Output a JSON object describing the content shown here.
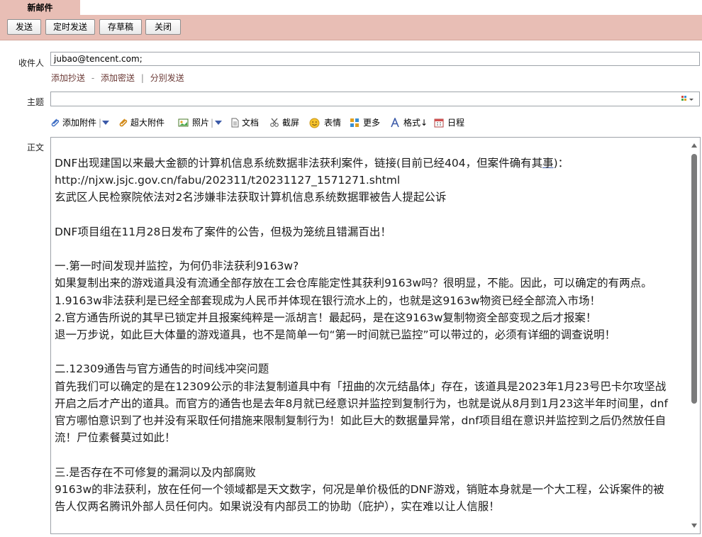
{
  "tab": {
    "title": "新邮件"
  },
  "toolbar": {
    "send": "发送",
    "scheduled": "定时发送",
    "draft": "存草稿",
    "close": "关闭"
  },
  "compose": {
    "to_label": "收件人",
    "to_value": "jubao@tencent.com",
    "to_sep": ";",
    "links": {
      "cc": "添加抄送",
      "dash": "-",
      "bcc": "添加密送",
      "bar": "|",
      "split": "分别发送"
    },
    "subject_label": "主题",
    "subject_value": "",
    "body_label": "正文"
  },
  "attach_bar": {
    "attach": "添加附件",
    "bar1": "|",
    "large": "超大附件",
    "photo": "照片",
    "bar2": "|",
    "doc": "文档",
    "screenshot": "截屏",
    "emoji": "表情",
    "more": "更多",
    "format": "格式↓",
    "calendar": "日程"
  },
  "body": {
    "l1a": "DNF出现建国以来最大金额的计算机信息系统数据非法获利案件，链接(目前已经404，但案件确有其",
    "l1b": "事",
    "l1c": ")：",
    "l2": "http://njxw.jsjc.gov.cn/fabu/202311/t20231127_1571271.shtml",
    "l3": "玄武区人民检察院依法对2名涉嫌非法获取计算机信息系统数据罪被告人提起公诉",
    "l4": "DNF项目组在11月28日发布了案件的公告，但极为笼统且错漏百出！",
    "l5": "一.第一时间发现并监控，为何仍非法获利9163w?",
    "l6": "如果复制出来的游戏道具没有流通全部存放在工会仓库能定性其获利9163w吗？很明显，不能。因此，可以确定的有两点。",
    "l7": "1.9163w非法获利是已经全部套现成为人民币并体现在银行流水上的，也就是这9163w物资已经全部流入市场！",
    "l8": "2.官方通告所说的其早已锁定并且报案纯粹是一派胡言！最起码，是在这9163w复制物资全部变现之后才报案！",
    "l9": "退一万步说，如此巨大体量的游戏道具，也不是简单一句“第一时间就已监控”可以带过的，必须有详细的调查说明！",
    "l10": "二.12309通告与官方通告的时间线冲突问题",
    "l11": "首先我们可以确定的是在12309公示的非法复制道具中有「扭曲的次元结晶体」存在，该道具是2023年1月23号巴卡尔攻坚战",
    "l12": "开启之后才产出的道具。而官方的通告也是去年8月就已经意识并监控到复制行为，也就是说从8月到1月23这半年时间里，dnf",
    "l13": "官方哪怕意识到了也并没有采取任何措施来限制复制行为！如此巨大的数据量异常，dnf项目组在意识并监控到之后仍然放任自",
    "l14": "流！尸位素餐莫过如此！",
    "l15": "三.是否存在不可修复的漏洞以及内部腐败",
    "l16": "9163w的非法获利，放在任何一个领域都是天文数字，何况是单价极低的DNF游戏，销赃本身就是一个大工程，公诉案件的被",
    "l17": "告人仅两名腾讯外部人员任何内。如果说没有内部员工的协助（庇护），实在难以让人信服！"
  }
}
